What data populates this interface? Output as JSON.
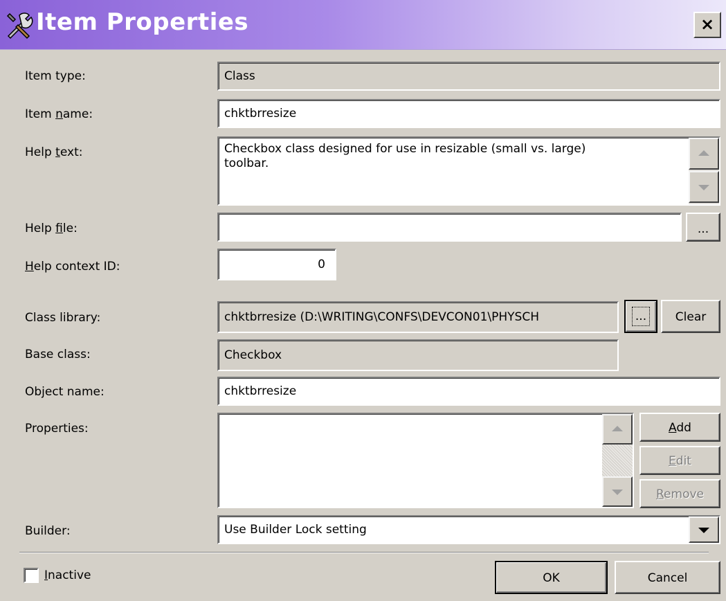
{
  "window": {
    "title": "Item Properties",
    "close_label": "×"
  },
  "labels": {
    "item_type": "Item type:",
    "item_name": {
      "pre": "Item ",
      "key": "n",
      "post": "ame:"
    },
    "help_text": {
      "pre": "Help ",
      "key": "t",
      "post": "ext:"
    },
    "help_file": {
      "pre": "Help ",
      "key": "f",
      "post": "ile:"
    },
    "help_context": {
      "pre": "",
      "key": "H",
      "post": "elp context ID:"
    },
    "class_library": "Class library:",
    "base_class": "Base class:",
    "object_name": "Object name:",
    "properties": "Properties:",
    "builder": "Builder:"
  },
  "fields": {
    "item_type": "Class",
    "item_name": "chktbrresize",
    "help_text_line1": "Checkbox class designed for use in resizable (small vs. large)",
    "help_text_line2": "toolbar.",
    "help_file": "",
    "help_context_id": "0",
    "class_library": "chktbrresize (D:\\WRITING\\CONFS\\DEVCON01\\PHYSCH",
    "base_class": "Checkbox",
    "object_name": "chktbrresize",
    "builder": "Use Builder Lock setting"
  },
  "buttons": {
    "help_file_browse": "...",
    "class_library_browse": "...",
    "clear": "Clear",
    "add": {
      "pre": "",
      "key": "A",
      "post": "dd"
    },
    "edit": {
      "pre": "",
      "key": "E",
      "post": "dit"
    },
    "remove": {
      "pre": "",
      "key": "R",
      "post": "emove"
    },
    "ok": "OK",
    "cancel": "Cancel"
  },
  "inactive": {
    "pre": "",
    "key": "I",
    "post": "nactive",
    "checked": false
  },
  "colors": {
    "titlebar_start": "#8a62d8",
    "titlebar_end": "#ece8fa",
    "face": "#d4d0c8"
  }
}
